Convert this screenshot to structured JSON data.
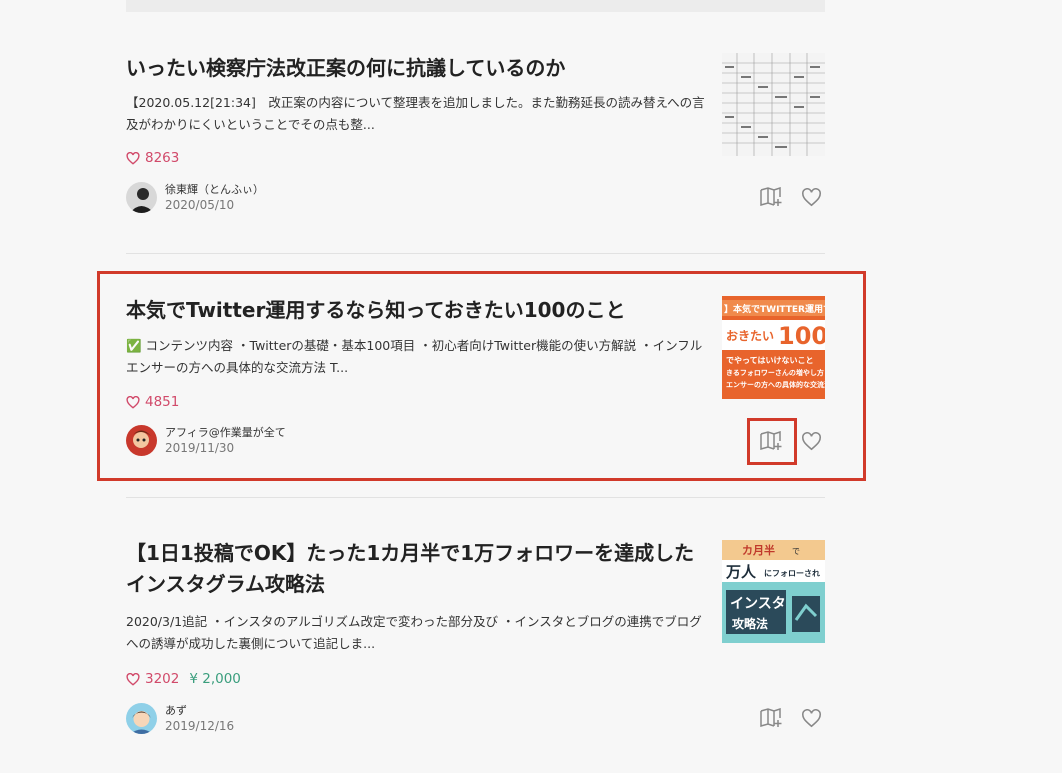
{
  "articles": [
    {
      "title": "いったい検察庁法改正案の何に抗議しているのか",
      "excerpt": "【2020.05.12[21:34]　改正案の内容について整理表を追加しました。また勤務延長の読み替えへの言及がわかりにくいということでその点も整...",
      "likes": "8263",
      "author": "徐東輝（とんふぃ）",
      "date": "2020/05/10"
    },
    {
      "title": "本気でTwitter運用するなら知っておきたい100のこと",
      "excerpt": "✅ コンテンツ内容 ・Twitterの基礎・基本100項目 ・初心者向けTwitter機能の使い方解説 ・インフルエンサーの方への具体的な交流方法 T...",
      "likes": "4851",
      "author": "アフィラ@作業量が全て",
      "date": "2019/11/30",
      "thumb_texts": [
        "】本気でTWITTER運用す",
        "おきたい",
        "100",
        "でやってはいけないこと",
        "きるフォロワーさんの増やし方",
        "エンサーの方への具体的な交流法"
      ]
    },
    {
      "title": "【1日1投稿でOK】たった1カ月半で1万フォロワーを達成したインスタグラム攻略法",
      "excerpt": "2020/3/1追記 ・インスタのアルゴリズム改定で変わった部分及び ・インスタとブログの連携でブログへの誘導が成功した裏側について追記しま...",
      "likes": "3202",
      "price": "¥ 2,000",
      "author": "あず",
      "date": "2019/12/16",
      "thumb_texts": [
        "カ月半",
        "で",
        "万人",
        "にフォローされ",
        "インスタ",
        "攻略法"
      ]
    }
  ],
  "icons": {
    "like": "heart-icon",
    "save": "magazine-add-icon"
  },
  "colors": {
    "like": "#d14a6a",
    "price": "#3a9e7d",
    "highlight": "#d13a2a"
  }
}
